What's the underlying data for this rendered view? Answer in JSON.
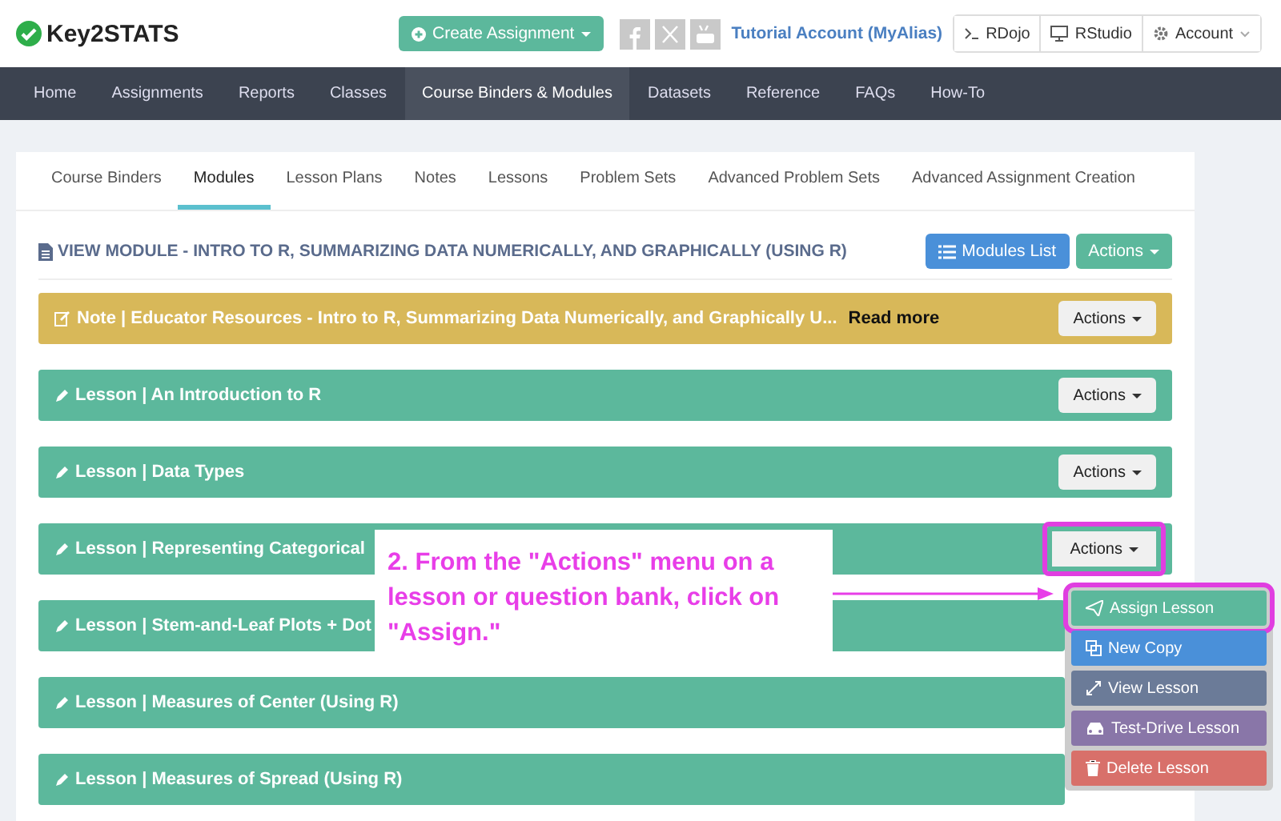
{
  "header": {
    "logo": "Key2STATS",
    "create_button": "Create Assignment",
    "account_link": "Tutorial Account (MyAlias)",
    "tools": [
      {
        "kind": "terminal",
        "label": "RDojo"
      },
      {
        "kind": "monitor",
        "label": "RStudio"
      },
      {
        "kind": "gear",
        "label": "Account"
      }
    ]
  },
  "nav": [
    {
      "label": "Home",
      "selected": false
    },
    {
      "label": "Assignments",
      "selected": false
    },
    {
      "label": "Reports",
      "selected": false
    },
    {
      "label": "Classes",
      "selected": false
    },
    {
      "label": "Course Binders & Modules",
      "selected": true
    },
    {
      "label": "Datasets",
      "selected": false
    },
    {
      "label": "Reference",
      "selected": false
    },
    {
      "label": "FAQs",
      "selected": false
    },
    {
      "label": "How-To",
      "selected": false
    }
  ],
  "tabs": [
    {
      "label": "Course Binders",
      "selected": false
    },
    {
      "label": "Modules",
      "selected": true
    },
    {
      "label": "Lesson Plans",
      "selected": false
    },
    {
      "label": "Notes",
      "selected": false
    },
    {
      "label": "Lessons",
      "selected": false
    },
    {
      "label": "Problem Sets",
      "selected": false
    },
    {
      "label": "Advanced Problem Sets",
      "selected": false
    },
    {
      "label": "Advanced Assignment Creation",
      "selected": false
    }
  ],
  "module": {
    "title": "VIEW MODULE - INTRO TO R, SUMMARIZING DATA NUMERICALLY, AND GRAPHICALLY (USING R)",
    "list_button": "Modules List",
    "actions_button": "Actions"
  },
  "rows": [
    {
      "kind": "note",
      "title": "Note | Educator Resources - Intro to R, Summarizing Data Numerically, and Graphically U...",
      "read_more": "Read more",
      "actions": "Actions",
      "highlighted": false
    },
    {
      "kind": "lesson",
      "title": "Lesson | An Introduction to R",
      "actions": "Actions",
      "highlighted": false
    },
    {
      "kind": "lesson",
      "title": "Lesson | Data Types",
      "actions": "Actions",
      "highlighted": false
    },
    {
      "kind": "lesson",
      "title": "Lesson | Representing Categorical",
      "actions": "Actions",
      "highlighted": true
    },
    {
      "kind": "lesson",
      "title": "Lesson | Stem-and-Leaf Plots + Dot"
    },
    {
      "kind": "lesson",
      "title": "Lesson | Measures of Center (Using R)"
    },
    {
      "kind": "lesson",
      "title": "Lesson | Measures of Spread (Using R)"
    }
  ],
  "callout": "2. From the \"Actions\" menu on a lesson or question bank, click on \"Assign.\"",
  "menu": [
    {
      "kind": "assign",
      "label": "Assign Lesson",
      "color": "#5cb89c",
      "highlighted": true
    },
    {
      "kind": "copy",
      "label": "New Copy",
      "color": "#4a90d9",
      "highlighted": false
    },
    {
      "kind": "view",
      "label": "View Lesson",
      "color": "#6b7b98",
      "highlighted": false
    },
    {
      "kind": "drive",
      "label": "Test-Drive Lesson",
      "color": "#8976a8",
      "highlighted": false
    },
    {
      "kind": "delete",
      "label": "Delete Lesson",
      "color": "#d8706a",
      "highlighted": false
    }
  ]
}
